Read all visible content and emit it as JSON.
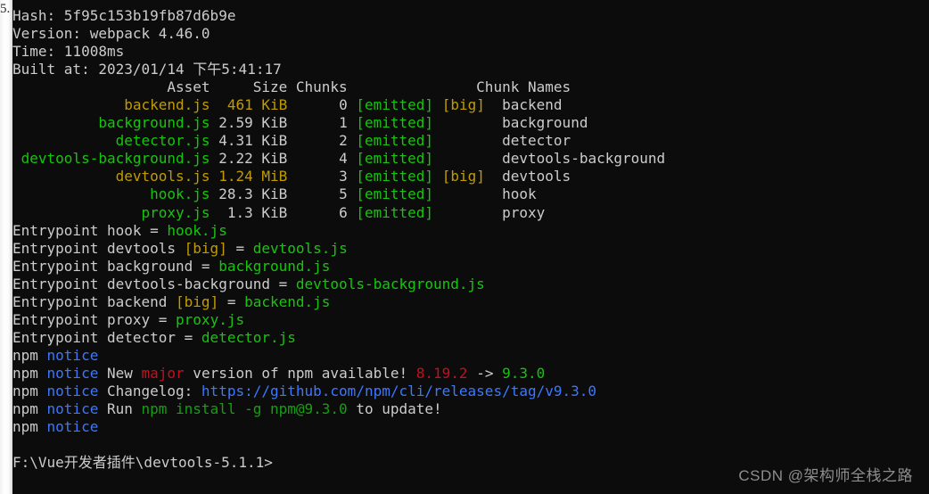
{
  "page_edge": {
    "partial_text": "5."
  },
  "terminal": {
    "background_color": "#0c0c0c",
    "colors": {
      "default": "#cccccc",
      "green": "#16c60c",
      "dark_green": "#13a10e",
      "yellow": "#c19c00",
      "blue": "#3b78ff",
      "red": "#c50f1f"
    },
    "build_info": {
      "hash_label": "Hash:",
      "hash_value": "5f95c153b19fb87d6b9e",
      "version_label": "Version:",
      "version_value": "webpack 4.46.0",
      "time_label": "Time:",
      "time_value": "11008ms",
      "built_at_label": "Built at:",
      "built_at_value": "2023/01/14 下午5:41:17"
    },
    "asset_table": {
      "headers": {
        "asset": "Asset",
        "size": "Size",
        "chunks": "Chunks",
        "chunk_names": "Chunk Names"
      },
      "rows": [
        {
          "asset": "backend.js",
          "size": "461 KiB",
          "size_big": true,
          "chunk": "0",
          "emitted": "[emitted]",
          "big": "[big]",
          "chunk_name": "backend",
          "asset_big": true
        },
        {
          "asset": "background.js",
          "size": "2.59 KiB",
          "size_big": false,
          "chunk": "1",
          "emitted": "[emitted]",
          "big": "",
          "chunk_name": "background",
          "asset_big": false
        },
        {
          "asset": "detector.js",
          "size": "4.31 KiB",
          "size_big": false,
          "chunk": "2",
          "emitted": "[emitted]",
          "big": "",
          "chunk_name": "detector",
          "asset_big": false
        },
        {
          "asset": "devtools-background.js",
          "size": "2.22 KiB",
          "size_big": false,
          "chunk": "4",
          "emitted": "[emitted]",
          "big": "",
          "chunk_name": "devtools-background",
          "asset_big": false
        },
        {
          "asset": "devtools.js",
          "size": "1.24 MiB",
          "size_big": true,
          "chunk": "3",
          "emitted": "[emitted]",
          "big": "[big]",
          "chunk_name": "devtools",
          "asset_big": true
        },
        {
          "asset": "hook.js",
          "size": "28.3 KiB",
          "size_big": false,
          "chunk": "5",
          "emitted": "[emitted]",
          "big": "",
          "chunk_name": "hook",
          "asset_big": false
        },
        {
          "asset": "proxy.js",
          "size": "1.3 KiB",
          "size_big": false,
          "chunk": "6",
          "emitted": "[emitted]",
          "big": "",
          "chunk_name": "proxy",
          "asset_big": false
        }
      ]
    },
    "entrypoints": {
      "keyword": "Entrypoint",
      "items": [
        {
          "name": "hook",
          "big": "",
          "file": "hook.js"
        },
        {
          "name": "devtools",
          "big": "[big]",
          "file": "devtools.js"
        },
        {
          "name": "background",
          "big": "",
          "file": "background.js"
        },
        {
          "name": "devtools-background",
          "big": "",
          "file": "devtools-background.js"
        },
        {
          "name": "backend",
          "big": "[big]",
          "file": "backend.js"
        },
        {
          "name": "proxy",
          "big": "",
          "file": "proxy.js"
        },
        {
          "name": "detector",
          "big": "",
          "file": "detector.js"
        }
      ]
    },
    "npm_notice": {
      "prefix": "npm",
      "keyword": "notice",
      "blank_line": "",
      "update_line": {
        "text_before": "New ",
        "major": "major",
        "text_middle": " version of npm available! ",
        "current_version": "8.19.2",
        "arrow": " -> ",
        "new_version": "9.3.0"
      },
      "changelog_line": {
        "label": "Changelog: ",
        "url": "https://github.com/npm/cli/releases/tag/v9.3.0"
      },
      "run_line": {
        "text_before": "Run ",
        "command": "npm install -g npm@9.3.0",
        "text_after": " to update!"
      }
    },
    "prompt": "F:\\Vue开发者插件\\devtools-5.1.1>"
  },
  "watermark": "CSDN @架构师全栈之路"
}
